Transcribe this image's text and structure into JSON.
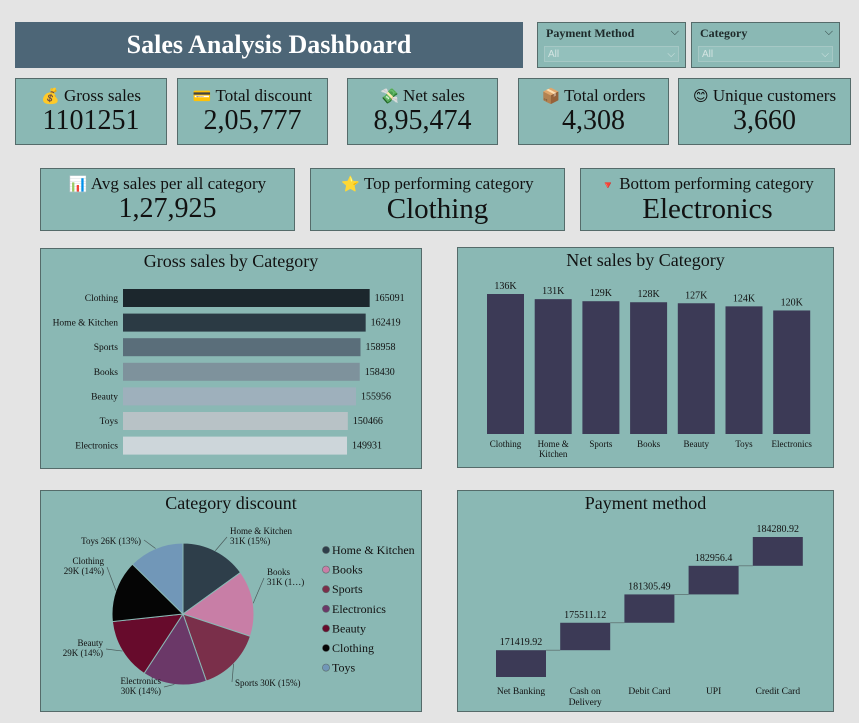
{
  "header": {
    "title": "Sales Analysis Dashboard"
  },
  "slicers": {
    "payment": {
      "label": "Payment Method",
      "value": "All"
    },
    "category": {
      "label": "Category",
      "value": "All"
    }
  },
  "kpis": {
    "gross_sales": {
      "icon": "💰",
      "label": "Gross sales",
      "value": "1101251"
    },
    "total_discount": {
      "icon": "💳",
      "label": "Total discount",
      "value": "2,05,777"
    },
    "net_sales": {
      "icon": "💸",
      "label": "Net sales",
      "value": "8,95,474"
    },
    "total_orders": {
      "icon": "📦",
      "label": "Total orders",
      "value": "4,308"
    },
    "unique_customers": {
      "icon": "😊",
      "label": "Unique customers",
      "value": "3,660"
    },
    "avg_sales": {
      "icon": "📊",
      "label": "Avg sales per all category",
      "value": "1,27,925"
    },
    "top_category": {
      "icon": "⭐",
      "label": "Top performing category",
      "value": "Clothing"
    },
    "bottom_category": {
      "icon": "🔻",
      "label": "Bottom performing category",
      "value": "Electronics"
    }
  },
  "chart_data": [
    {
      "id": "gross",
      "type": "bar",
      "orientation": "horizontal",
      "title": "Gross sales by Category",
      "categories": [
        "Clothing",
        "Home & Kitchen",
        "Sports",
        "Books",
        "Beauty",
        "Toys",
        "Electronics"
      ],
      "values": [
        165091,
        162419,
        158958,
        158430,
        155956,
        150466,
        149931
      ],
      "colors": [
        "#1c272d",
        "#2b3a44",
        "#5a6e7a",
        "#7e929c",
        "#9eb0bc",
        "#b8c2c6",
        "#cdd6da"
      ],
      "xlim": [
        0,
        170000
      ]
    },
    {
      "id": "net",
      "type": "bar",
      "title": "Net sales by Category",
      "categories": [
        "Clothing",
        "Home & Kitchen",
        "Sports",
        "Books",
        "Beauty",
        "Toys",
        "Electronics"
      ],
      "category_lines": [
        [
          "Clothing"
        ],
        [
          "Home &",
          "Kitchen"
        ],
        [
          "Sports"
        ],
        [
          "Books"
        ],
        [
          "Beauty"
        ],
        [
          "Toys"
        ],
        [
          "Electronics"
        ]
      ],
      "values": [
        136,
        131,
        129,
        128,
        127,
        124,
        120
      ],
      "labels": [
        "136K",
        "131K",
        "129K",
        "128K",
        "127K",
        "124K",
        "120K"
      ],
      "color": "#3c3a56",
      "ylim": [
        0,
        136
      ]
    },
    {
      "id": "discount",
      "type": "pie",
      "title": "Category discount",
      "slices": [
        {
          "name": "Home & Kitchen",
          "value": 31,
          "color": "#2e3e4a",
          "label": [
            "Home & Kitchen",
            "31K (15%)"
          ]
        },
        {
          "name": "Books",
          "value": 31,
          "color": "#c87ea6",
          "label": [
            "Books",
            "31K (1…)"
          ]
        },
        {
          "name": "Sports",
          "value": 30,
          "color": "#7a2f4a",
          "label": [
            "Sports 30K (15%)"
          ]
        },
        {
          "name": "Electronics",
          "value": 30,
          "color": "#6b3868",
          "label": [
            "Electronics",
            "30K (14%)"
          ]
        },
        {
          "name": "Beauty",
          "value": 29,
          "color": "#670b2c",
          "label": [
            "Beauty",
            "29K (14%)"
          ]
        },
        {
          "name": "Clothing",
          "value": 29,
          "color": "#050505",
          "label": [
            "Clothing",
            "29K (14%)"
          ]
        },
        {
          "name": "Toys",
          "value": 26,
          "color": "#7197b8",
          "label": [
            "Toys 26K (13%)"
          ]
        }
      ],
      "legend": [
        "Home & Kitchen",
        "Books",
        "Sports",
        "Electronics",
        "Beauty",
        "Clothing",
        "Toys"
      ],
      "legend_placement": "right"
    },
    {
      "id": "payment",
      "type": "waterfall",
      "title": "Payment method",
      "categories": [
        "Net Banking",
        "Cash on Delivery",
        "Debit Card",
        "UPI",
        "Credit Card"
      ],
      "category_lines": [
        [
          "Net Banking"
        ],
        [
          "Cash on",
          "Delivery"
        ],
        [
          "Debit Card"
        ],
        [
          "UPI"
        ],
        [
          "Credit Card"
        ]
      ],
      "values": [
        171419.92,
        175511.12,
        181305.49,
        182956.4,
        184280.92
      ],
      "labels": [
        "171419.92",
        "175511.12",
        "181305.49",
        "182956.4",
        "184280.92"
      ],
      "color": "#3c3a56"
    }
  ]
}
